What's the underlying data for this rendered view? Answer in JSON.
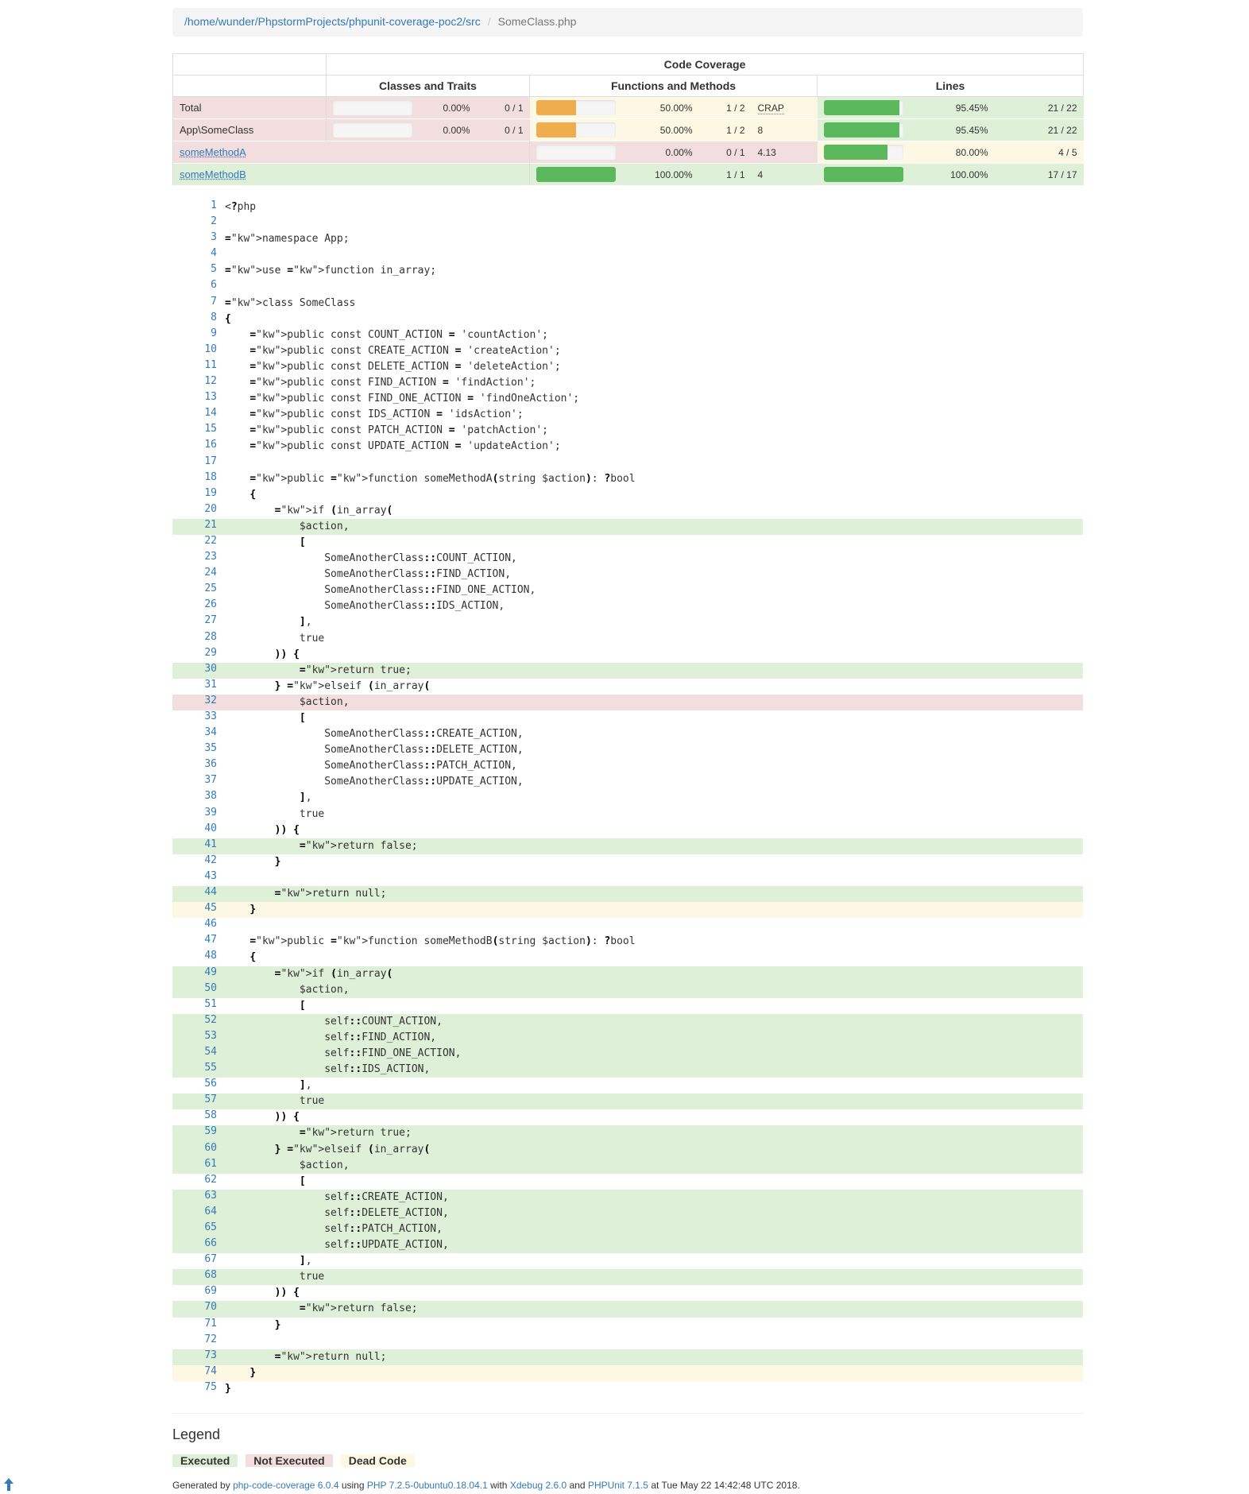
{
  "breadcrumb": {
    "path": "/home/wunder/PhpstormProjects/phpunit-coverage-poc2/src",
    "file": "SomeClass.php"
  },
  "table": {
    "header_top": "Code Coverage",
    "headers": {
      "classes": "Classes and Traits",
      "functions": "Functions and Methods",
      "lines": "Lines"
    },
    "rows": [
      {
        "name": "Total",
        "cls_pct": "0.00%",
        "cls_frac": "0 / 1",
        "cls_fill": 0,
        "fn_pct": "50.00%",
        "fn_frac": "1 / 2",
        "fn_fill": 50,
        "crap": "CRAP",
        "ln_pct": "95.45%",
        "ln_frac": "21 / 22",
        "ln_fill": 95.45
      },
      {
        "name": "App\\SomeClass",
        "cls_pct": "0.00%",
        "cls_frac": "0 / 1",
        "cls_fill": 0,
        "fn_pct": "50.00%",
        "fn_frac": "1 / 2",
        "fn_fill": 50,
        "crap": "8",
        "ln_pct": "95.45%",
        "ln_frac": "21 / 22",
        "ln_fill": 95.45
      },
      {
        "name": "someMethodA",
        "fn_pct": "0.00%",
        "fn_frac": "0 / 1",
        "fn_fill": 0,
        "crap": "4.13",
        "ln_pct": "80.00%",
        "ln_frac": "4 / 5",
        "ln_fill": 80
      },
      {
        "name": "someMethodB",
        "fn_pct": "100.00%",
        "fn_frac": "1 / 1",
        "fn_fill": 100,
        "crap": "4",
        "ln_pct": "100.00%",
        "ln_frac": "17 / 17",
        "ln_fill": 100
      }
    ]
  },
  "colors": {
    "executed": "#dff0d8",
    "not_executed": "#f2dede",
    "dead_code": "#fcf8e3",
    "bar_warning": "#f0ad4e",
    "bar_success": "#5cb85c",
    "link": "#337ab7"
  },
  "source": [
    {
      "n": "1",
      "t": "<?php",
      "s": ""
    },
    {
      "n": "2",
      "t": "",
      "s": ""
    },
    {
      "n": "3",
      "t": "namespace App;",
      "s": ""
    },
    {
      "n": "4",
      "t": "",
      "s": ""
    },
    {
      "n": "5",
      "t": "use function in_array;",
      "s": ""
    },
    {
      "n": "6",
      "t": "",
      "s": ""
    },
    {
      "n": "7",
      "t": "class SomeClass",
      "s": ""
    },
    {
      "n": "8",
      "t": "{",
      "s": ""
    },
    {
      "n": "9",
      "t": "    public const COUNT_ACTION = 'countAction';",
      "s": ""
    },
    {
      "n": "10",
      "t": "    public const CREATE_ACTION = 'createAction';",
      "s": ""
    },
    {
      "n": "11",
      "t": "    public const DELETE_ACTION = 'deleteAction';",
      "s": ""
    },
    {
      "n": "12",
      "t": "    public const FIND_ACTION = 'findAction';",
      "s": ""
    },
    {
      "n": "13",
      "t": "    public const FIND_ONE_ACTION = 'findOneAction';",
      "s": ""
    },
    {
      "n": "14",
      "t": "    public const IDS_ACTION = 'idsAction';",
      "s": ""
    },
    {
      "n": "15",
      "t": "    public const PATCH_ACTION = 'patchAction';",
      "s": ""
    },
    {
      "n": "16",
      "t": "    public const UPDATE_ACTION = 'updateAction';",
      "s": ""
    },
    {
      "n": "17",
      "t": "",
      "s": ""
    },
    {
      "n": "18",
      "t": "    public function someMethodA(string $action): ?bool",
      "s": ""
    },
    {
      "n": "19",
      "t": "    {",
      "s": ""
    },
    {
      "n": "20",
      "t": "        if (in_array(",
      "s": ""
    },
    {
      "n": "21",
      "t": "            $action,",
      "s": "ex"
    },
    {
      "n": "22",
      "t": "            [",
      "s": ""
    },
    {
      "n": "23",
      "t": "                SomeAnotherClass::COUNT_ACTION,",
      "s": ""
    },
    {
      "n": "24",
      "t": "                SomeAnotherClass::FIND_ACTION,",
      "s": ""
    },
    {
      "n": "25",
      "t": "                SomeAnotherClass::FIND_ONE_ACTION,",
      "s": ""
    },
    {
      "n": "26",
      "t": "                SomeAnotherClass::IDS_ACTION,",
      "s": ""
    },
    {
      "n": "27",
      "t": "            ],",
      "s": ""
    },
    {
      "n": "28",
      "t": "            true",
      "s": ""
    },
    {
      "n": "29",
      "t": "        )) {",
      "s": ""
    },
    {
      "n": "30",
      "t": "            return true;",
      "s": "ex"
    },
    {
      "n": "31",
      "t": "        } elseif (in_array(",
      "s": ""
    },
    {
      "n": "32",
      "t": "            $action,",
      "s": "nx"
    },
    {
      "n": "33",
      "t": "            [",
      "s": ""
    },
    {
      "n": "34",
      "t": "                SomeAnotherClass::CREATE_ACTION,",
      "s": ""
    },
    {
      "n": "35",
      "t": "                SomeAnotherClass::DELETE_ACTION,",
      "s": ""
    },
    {
      "n": "36",
      "t": "                SomeAnotherClass::PATCH_ACTION,",
      "s": ""
    },
    {
      "n": "37",
      "t": "                SomeAnotherClass::UPDATE_ACTION,",
      "s": ""
    },
    {
      "n": "38",
      "t": "            ],",
      "s": ""
    },
    {
      "n": "39",
      "t": "            true",
      "s": ""
    },
    {
      "n": "40",
      "t": "        )) {",
      "s": ""
    },
    {
      "n": "41",
      "t": "            return false;",
      "s": "ex"
    },
    {
      "n": "42",
      "t": "        }",
      "s": ""
    },
    {
      "n": "43",
      "t": "",
      "s": ""
    },
    {
      "n": "44",
      "t": "        return null;",
      "s": "ex"
    },
    {
      "n": "45",
      "t": "    }",
      "s": "dc"
    },
    {
      "n": "46",
      "t": "",
      "s": ""
    },
    {
      "n": "47",
      "t": "    public function someMethodB(string $action): ?bool",
      "s": ""
    },
    {
      "n": "48",
      "t": "    {",
      "s": ""
    },
    {
      "n": "49",
      "t": "        if (in_array(",
      "s": "ex"
    },
    {
      "n": "50",
      "t": "            $action,",
      "s": "ex"
    },
    {
      "n": "51",
      "t": "            [",
      "s": ""
    },
    {
      "n": "52",
      "t": "                self::COUNT_ACTION,",
      "s": "ex"
    },
    {
      "n": "53",
      "t": "                self::FIND_ACTION,",
      "s": "ex"
    },
    {
      "n": "54",
      "t": "                self::FIND_ONE_ACTION,",
      "s": "ex"
    },
    {
      "n": "55",
      "t": "                self::IDS_ACTION,",
      "s": "ex"
    },
    {
      "n": "56",
      "t": "            ],",
      "s": ""
    },
    {
      "n": "57",
      "t": "            true",
      "s": "ex"
    },
    {
      "n": "58",
      "t": "        )) {",
      "s": ""
    },
    {
      "n": "59",
      "t": "            return true;",
      "s": "ex"
    },
    {
      "n": "60",
      "t": "        } elseif (in_array(",
      "s": "ex"
    },
    {
      "n": "61",
      "t": "            $action,",
      "s": "ex"
    },
    {
      "n": "62",
      "t": "            [",
      "s": ""
    },
    {
      "n": "63",
      "t": "                self::CREATE_ACTION,",
      "s": "ex"
    },
    {
      "n": "64",
      "t": "                self::DELETE_ACTION,",
      "s": "ex"
    },
    {
      "n": "65",
      "t": "                self::PATCH_ACTION,",
      "s": "ex"
    },
    {
      "n": "66",
      "t": "                self::UPDATE_ACTION,",
      "s": "ex"
    },
    {
      "n": "67",
      "t": "            ],",
      "s": ""
    },
    {
      "n": "68",
      "t": "            true",
      "s": "ex"
    },
    {
      "n": "69",
      "t": "        )) {",
      "s": ""
    },
    {
      "n": "70",
      "t": "            return false;",
      "s": "ex"
    },
    {
      "n": "71",
      "t": "        }",
      "s": ""
    },
    {
      "n": "72",
      "t": "",
      "s": ""
    },
    {
      "n": "73",
      "t": "        return null;",
      "s": "ex"
    },
    {
      "n": "74",
      "t": "    }",
      "s": "dc"
    },
    {
      "n": "75",
      "t": "}",
      "s": ""
    }
  ],
  "legend": {
    "title": "Legend",
    "executed": "Executed",
    "not_executed": "Not Executed",
    "dead_code": "Dead Code"
  },
  "footer": {
    "generated_by": "Generated by",
    "coverage_link": "php-code-coverage 6.0.4",
    "using": "using",
    "php_link": "PHP 7.2.5-0ubuntu0.18.04.1",
    "with": "with",
    "xdebug_link": "Xdebug 2.6.0",
    "and": "and",
    "phpunit_link": "PHPUnit 7.1.5",
    "at": "at Tue May 22 14:42:48 UTC 2018."
  },
  "back_to_top_icon": "arrow-up-icon"
}
